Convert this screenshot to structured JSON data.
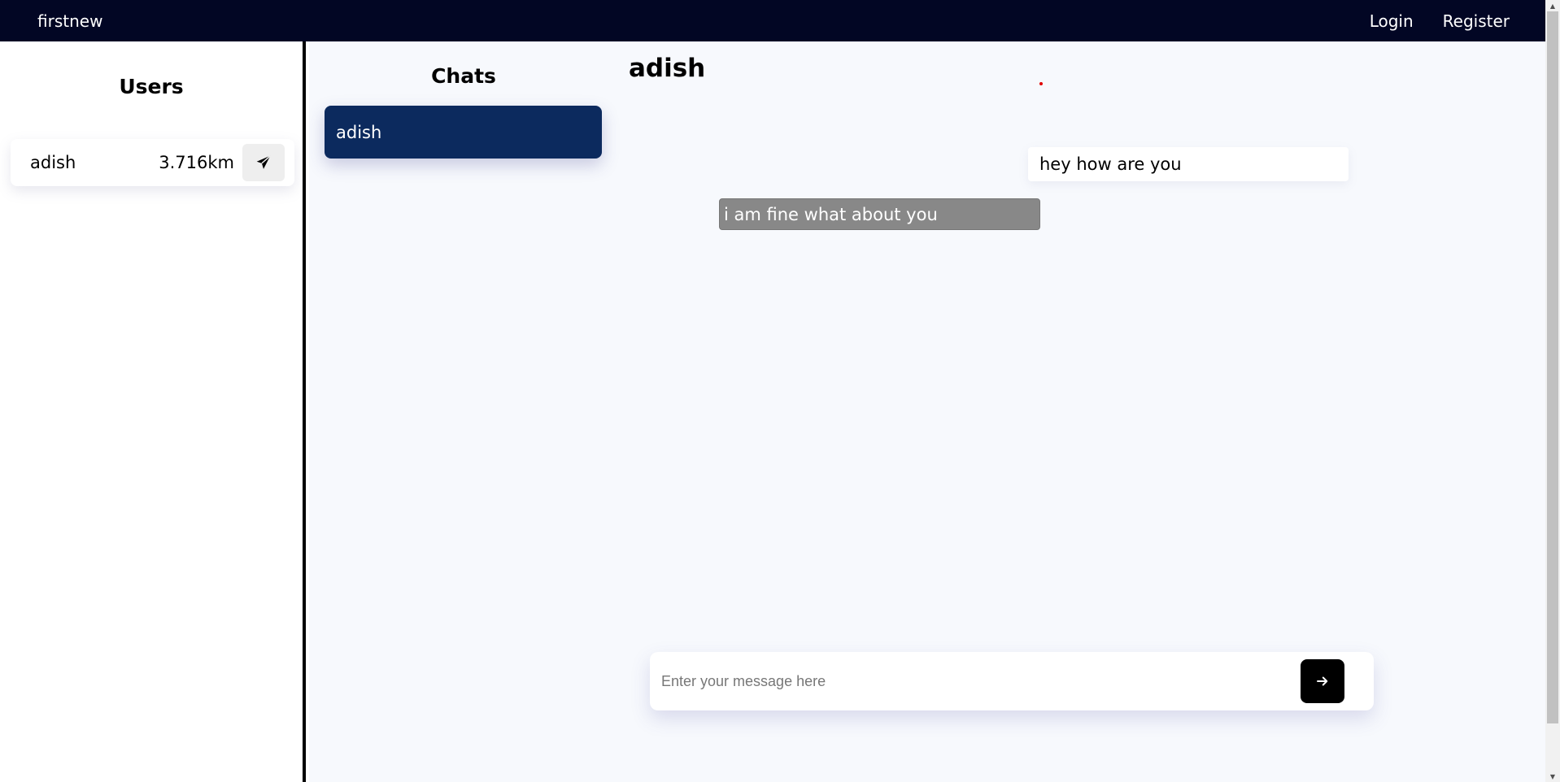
{
  "navbar": {
    "brand": "firstnew",
    "links": [
      {
        "label": "Login"
      },
      {
        "label": "Register"
      }
    ],
    "background_color": "#020624"
  },
  "users_panel": {
    "title": "Users",
    "users": [
      {
        "name": "adish",
        "distance": "3.716km",
        "action_icon": "paper-plane-icon"
      }
    ]
  },
  "chats_panel": {
    "title": "Chats",
    "chats": [
      {
        "name": "adish",
        "active": true
      }
    ],
    "active_color": "#0c2a5e"
  },
  "conversation": {
    "contact_name": "adish",
    "status_color": "#e00000",
    "messages": [
      {
        "text": "hey how are you",
        "direction": "outgoing"
      },
      {
        "text": "i am fine what about you",
        "direction": "incoming"
      }
    ]
  },
  "composer": {
    "placeholder": "Enter your message here",
    "value": "",
    "send_icon": "arrow-right-icon"
  }
}
